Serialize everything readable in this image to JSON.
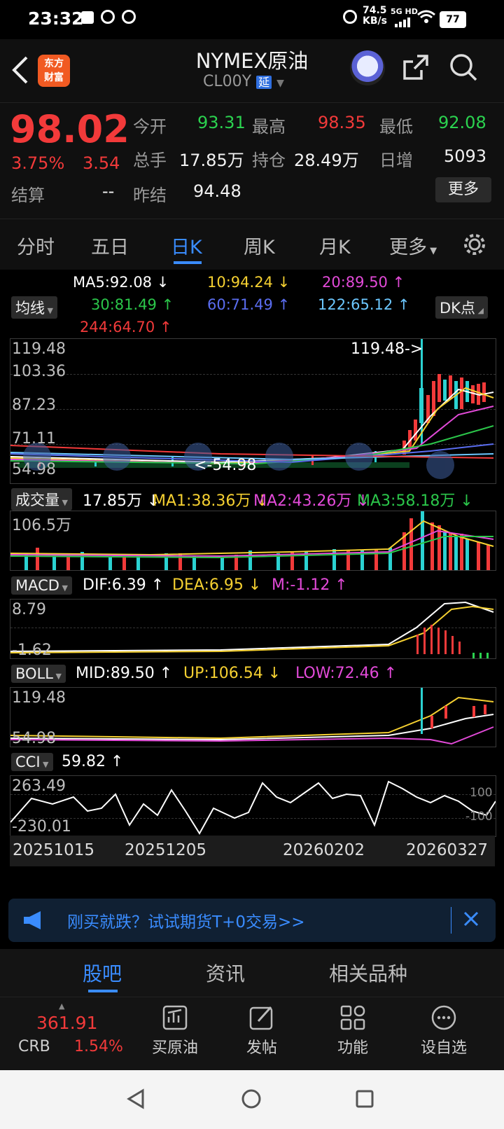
{
  "status_bar": {
    "time": "23:32",
    "net_speed_top": "74.5",
    "net_speed_bottom": "KB/s",
    "net_type": "5G HD",
    "battery": "77"
  },
  "header": {
    "logo_text_top": "东方",
    "logo_text_bottom": "财富",
    "title": "NYMEX原油",
    "code": "CL00Y",
    "delay_badge": "延"
  },
  "quote": {
    "price": "98.02",
    "change_pct": "3.75%",
    "change_abs": "3.54",
    "open_label": "今开",
    "open": "93.31",
    "high_label": "最高",
    "high": "98.35",
    "low_label": "最低",
    "low": "92.08",
    "volume_label": "总手",
    "volume": "17.85万",
    "oi_label": "持仓",
    "oi": "28.49万",
    "daily_inc_label": "日增",
    "daily_inc": "5093",
    "settle_label": "结算",
    "settle": "--",
    "prev_settle_label": "昨结",
    "prev_settle": "94.48",
    "more_button": "更多"
  },
  "period_tabs": [
    "分时",
    "五日",
    "日K",
    "周K",
    "月K",
    "更多"
  ],
  "active_tab": "日K",
  "chart": {
    "ma_selector": "均线",
    "dk_button": "DK点",
    "ma": {
      "ma5": "MA5:92.08 ↓",
      "ma10": "10:94.24 ↓",
      "ma20": "20:89.50 ↑",
      "ma30": "30:81.49 ↑",
      "ma60": "60:71.49 ↑",
      "ma122": "122:65.12 ↑",
      "ma244": "244:64.70 ↑"
    },
    "price_axis": [
      "119.48",
      "103.36",
      "87.23",
      "71.11",
      "54.98"
    ],
    "max_marker": "119.48->",
    "min_marker": "<-54.98",
    "volume": {
      "selector": "成交量",
      "vol": "17.85万 ↓",
      "ma1": "MA1:38.36万 ↓",
      "ma2": "MA2:43.26万 ↓",
      "ma3": "MA3:58.18万 ↓",
      "axis_top": "106.5万"
    },
    "macd": {
      "selector": "MACD",
      "dif": "DIF:6.39 ↑",
      "dea": "DEA:6.95 ↓",
      "m": "M:-1.12 ↑",
      "axis_top": "8.79",
      "axis_bottom": "-1.62"
    },
    "boll": {
      "selector": "BOLL",
      "mid": "MID:89.50 ↑",
      "up": "UP:106.54 ↓",
      "low": "LOW:72.46 ↑",
      "axis_top": "119.48",
      "axis_bottom": "54.98"
    },
    "cci": {
      "selector": "CCI",
      "value": "59.82 ↑",
      "axis_top": "263.49",
      "axis_bottom": "-230.01",
      "ref_top": "100",
      "ref_bottom": "-100"
    },
    "dates": [
      "20251015",
      "20251205",
      "20260202",
      "20260327"
    ]
  },
  "banner": {
    "text": "刚买就跌？试试期货T+0交易>>"
  },
  "bottom_tabs": [
    "股吧",
    "资讯",
    "相关品种"
  ],
  "toolbar": {
    "crb_value": "361.91",
    "crb_label": "CRB",
    "crb_change": "1.54%",
    "buy": "买原油",
    "post": "发帖",
    "functions": "功能",
    "watchlist": "设自选"
  },
  "colors": {
    "up": "#f23a3a",
    "down": "#2bd24f",
    "accent": "#2f8cff"
  }
}
